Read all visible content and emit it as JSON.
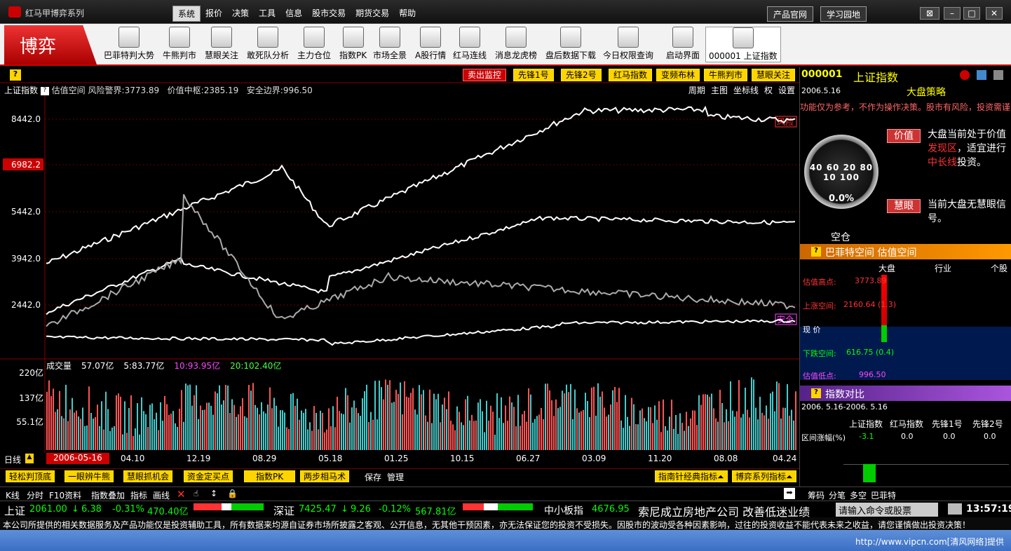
{
  "window": {
    "title": "红马甲博弈系列",
    "btn_product": "产品官网",
    "btn_study": "学习园地"
  },
  "menu": [
    "系统",
    "报价",
    "决策",
    "工具",
    "信息",
    "股市交易",
    "期货交易",
    "帮助"
  ],
  "brand": "博弈",
  "tools": [
    "巴菲特判大势",
    "牛熊判市",
    "慧眼关注",
    "敢死队分析",
    "主力仓位",
    "指数PK",
    "市场全景",
    "A股行情",
    "红马连线",
    "消息龙虎榜",
    "盘后数据下载",
    "今日权限查询",
    "启动界面",
    "000001  上证指数"
  ],
  "topbuttons": [
    "卖出监控",
    "先锋1号",
    "先锋2号",
    "红马指数",
    "变频布林",
    "牛熊判市",
    "慧眼关注"
  ],
  "info": {
    "name": "上证指数",
    "sub": "估值空间",
    "risk_label": "风险警界:",
    "risk": "3773.89",
    "mid_label": "价值中枢:",
    "mid": "2385.19",
    "safe_label": "安全边界:",
    "safe": "996.50"
  },
  "chartmenu": [
    "周期",
    "主图",
    "坐标线",
    "权",
    "设置"
  ],
  "yticks": [
    "8442.0",
    "6982.2",
    "5442.0",
    "3942.0",
    "2442.0"
  ],
  "tags": {
    "risk": "风险",
    "safe": "安全"
  },
  "volume": {
    "label": "成交量",
    "v1": "57.07亿",
    "v2": "5:83.77亿",
    "v3": "10:93.95亿",
    "v4": "20:102.40亿",
    "ticks": [
      "220亿",
      "137亿",
      "55.1亿"
    ]
  },
  "dates": {
    "period": "日线",
    "current": "2006-05-16",
    "labels": [
      "04.10",
      "12.19",
      "08.29",
      "05.18",
      "01.25",
      "10.15",
      "06.27",
      "03.09",
      "11.20",
      "08.08",
      "04.24"
    ]
  },
  "bottomtools": [
    "轻松判顶底",
    "一眼辨牛熊",
    "慧眼抓机会",
    "资金定买点",
    "指数PK",
    "两步相马术"
  ],
  "bottomright": [
    "指南针经典指标",
    "博弈系列指标"
  ],
  "saveman": [
    "保存",
    "管理"
  ],
  "bar1": [
    "K线",
    "分时",
    "F10资料",
    "指数叠加",
    "指标",
    "画线"
  ],
  "bar1right": [
    "筹码",
    "分笔",
    "多空",
    "巴菲特"
  ],
  "ticker": {
    "sh_name": "上证",
    "sh_val": "2061.00",
    "sh_chg": "6.38",
    "sh_pct": "-0.31%",
    "sh_amt": "470.40亿",
    "sz_name": "深证",
    "sz_val": "7425.47",
    "sz_chg": "9.26",
    "sz_pct": "-0.12%",
    "sz_amt": "567.81亿",
    "mid_name": "中小板指",
    "mid_val": "4676.95",
    "news": "索尼成立房地产公司 改善低迷业绩",
    "cmd": "请输入命令或股票",
    "time": "13:57:19"
  },
  "disclaimer": "本公司所提供的相关数据服务及产品功能仅是投资辅助工具，所有数据来均源自证券市场所披露之客观、公开信息，无其他干预因素，亦无法保证您的投资不受损失。因股市的波动受各种因素影响，过往的投资收益不能代表未来之收益，请您谨慎做出投资决策！",
  "status": "http://www.vipcn.com[清风网络]提供",
  "right": {
    "code": "000001",
    "name": "上证指数",
    "date": "2006.5.16",
    "strategy": "大盘策略",
    "scroll": "功能仅为参考，不作为操作决策。股市有风险，投资需谨",
    "btn_value": "价值",
    "text1a": "大盘当前处于价值",
    "text1b": "发现区",
    "text1c": "，适宜进行",
    "text1d": "中长线",
    "text1e": "投资。",
    "btn_eye": "慧眼",
    "text2": "当前大盘无慧眼信号。",
    "gauge": "0.0%",
    "empty": "空仓",
    "buffett_head": "巴菲特空间 估值空间",
    "cols": [
      "大盘",
      "行业",
      "个股"
    ],
    "hi_label": "估值高点:",
    "hi": "3773.89",
    "up_label": "上涨空间:",
    "up": "2160.64 (1.3)",
    "now": "现  价",
    "down_label": "下跌空间:",
    "down": "616.75 (0.4)",
    "lo_label": "估值低点:",
    "lo": "996.50",
    "pk_head": "指数对比",
    "pk_range": "2006. 5.16-2006. 5.16",
    "pk_cols": [
      "上证指数",
      "红马指数",
      "先锋1号",
      "先锋2号"
    ],
    "pk_row": "区间涨幅(%)",
    "pk_vals": [
      "-3.1",
      "0.0",
      "0.0",
      "0.0"
    ]
  }
}
